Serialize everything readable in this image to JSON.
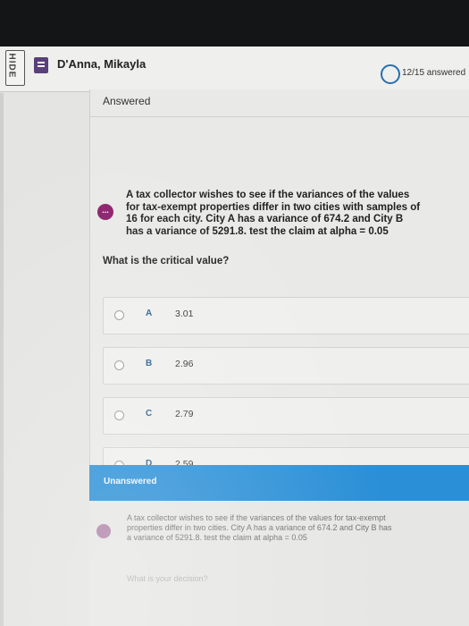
{
  "header": {
    "hide_label": "HIDE",
    "student_name": "D'Anna, Mikayla",
    "progress": "12/15 answered"
  },
  "question1": {
    "status": "Answered",
    "more_label": "...",
    "text": "A tax collector wishes to see if the variances of the values for tax-exempt properties differ in two cities with samples of 16 for each city. City A has a variance of 674.2 and City B has a variance of 5291.8. test the claim at alpha = 0.05",
    "prompt": "What is the critical value?",
    "options": [
      {
        "letter": "A",
        "value": "3.01"
      },
      {
        "letter": "B",
        "value": "2.96"
      },
      {
        "letter": "C",
        "value": "2.79"
      },
      {
        "letter": "D",
        "value": "2.59"
      }
    ]
  },
  "question2": {
    "status": "Unanswered",
    "text": "A tax collector wishes to see if the variances of the values for tax-exempt properties differ in two cities. City A has a variance of 674.2 and City B has a variance of 5291.8. test the claim at alpha = 0.05",
    "prompt": "What is your decision?"
  },
  "colors": {
    "accent": "#2a8fd6",
    "more_button": "#8a1f6b",
    "option_letter": "#2a5f8a"
  }
}
